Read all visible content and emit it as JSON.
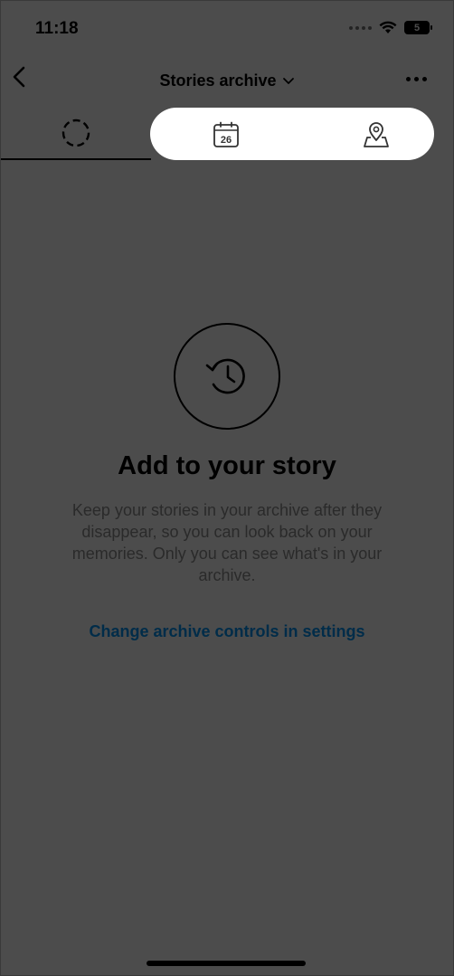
{
  "status": {
    "time": "11:18",
    "battery": "5"
  },
  "nav": {
    "title": "Stories archive",
    "back_icon": "chevron-left-icon",
    "title_chevron_icon": "chevron-down-icon",
    "more_icon": "more-horizontal-icon"
  },
  "tabs": [
    {
      "name": "stories",
      "icon": "dashed-circle-icon"
    },
    {
      "name": "calendar",
      "icon": "calendar-icon",
      "date": "26"
    },
    {
      "name": "map",
      "icon": "map-pin-icon"
    }
  ],
  "empty": {
    "icon": "history-clock-icon",
    "title": "Add to your story",
    "description": "Keep your stories in your archive after they disappear, so you can look back on your memories. Only you can see what's in your archive.",
    "link": "Change archive controls in settings"
  },
  "colors": {
    "link": "#0095f6",
    "text_secondary": "#8e8e8e",
    "overlay": "rgba(0,0,0,0.70)"
  }
}
